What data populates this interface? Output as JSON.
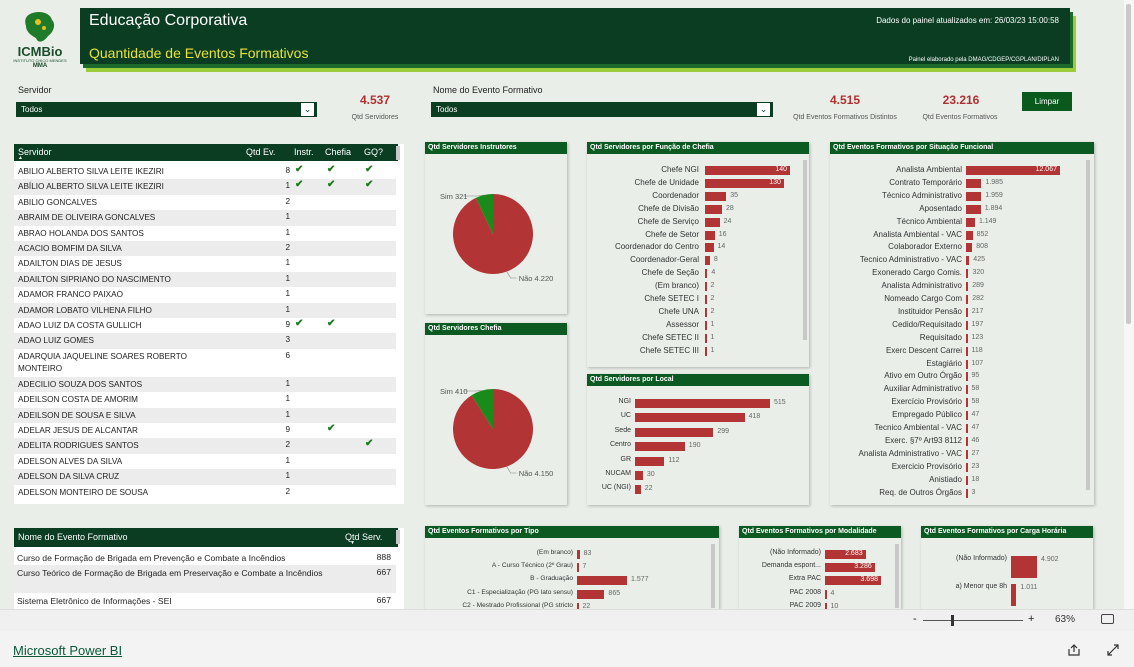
{
  "logo": {
    "text": "ICMBio",
    "small": "INSTITUTO CHICO MENDES",
    "ministry": "MMA"
  },
  "header": {
    "title": "Educação Corporativa",
    "subtitle": "Quantidade de Eventos Formativos",
    "updated": "Dados do painel atualizados em: 26/03/23 15:00:58",
    "credit": "Painel elaborado pela DMAG/CDGEP/CGPLAN/DIPLAN"
  },
  "slicers": {
    "servidor": {
      "label": "Servidor",
      "value": "Todos"
    },
    "evento": {
      "label": "Nome do Evento Formativo",
      "value": "Todos"
    }
  },
  "kpis": {
    "servidores": {
      "value": "4.537",
      "label": "Qtd Servidores"
    },
    "distintos": {
      "value": "4.515",
      "label": "Qtd Eventos Formativos Distintos"
    },
    "eventos": {
      "value": "23.216",
      "label": "Qtd Eventos Formativos"
    }
  },
  "buttons": {
    "limpar": "Limpar"
  },
  "servidor_table": {
    "headers": [
      "Servidor",
      "Qtd Ev.",
      "Instr.",
      "Chefia",
      "GQ?"
    ],
    "rows": [
      {
        "name": "ABILIO ALBERTO SILVA LEITE IKEZIRI",
        "qtd": "8",
        "i": 1,
        "c": 1,
        "g": 1
      },
      {
        "name": "ABÍLIO ALBERTO SILVA LEITE IKEZIRI",
        "qtd": "1",
        "i": 1,
        "c": 1,
        "g": 1
      },
      {
        "name": "ABILIO GONCALVES",
        "qtd": "2",
        "i": 0,
        "c": 0,
        "g": 0
      },
      {
        "name": "ABRAIM DE OLIVEIRA GONCALVES",
        "qtd": "1",
        "i": 0,
        "c": 0,
        "g": 0
      },
      {
        "name": "ABRAO HOLANDA DOS SANTOS",
        "qtd": "1",
        "i": 0,
        "c": 0,
        "g": 0
      },
      {
        "name": "ACACIO BOMFIM DA SILVA",
        "qtd": "2",
        "i": 0,
        "c": 0,
        "g": 0
      },
      {
        "name": "ADAILTON DIAS DE JESUS",
        "qtd": "1",
        "i": 0,
        "c": 0,
        "g": 0
      },
      {
        "name": "ADAILTON SIPRIANO DO NASCIMENTO",
        "qtd": "1",
        "i": 0,
        "c": 0,
        "g": 0
      },
      {
        "name": "ADAMOR FRANCO PAIXAO",
        "qtd": "1",
        "i": 0,
        "c": 0,
        "g": 0
      },
      {
        "name": "ADAMOR LOBATO VILHENA FILHO",
        "qtd": "1",
        "i": 0,
        "c": 0,
        "g": 0
      },
      {
        "name": "ADAO LUIZ DA COSTA GULLICH",
        "qtd": "9",
        "i": 1,
        "c": 1,
        "g": 0
      },
      {
        "name": "ADAO LUIZ GOMES",
        "qtd": "3",
        "i": 0,
        "c": 0,
        "g": 0
      },
      {
        "name": "ADARQUIA JAQUELINE SOARES ROBERTO MONTEIRO",
        "qtd": "6",
        "i": 0,
        "c": 0,
        "g": 0,
        "tall": 1
      },
      {
        "name": "ADECILIO SOUZA DOS SANTOS",
        "qtd": "1",
        "i": 0,
        "c": 0,
        "g": 0
      },
      {
        "name": "ADEILSON COSTA DE AMORIM",
        "qtd": "1",
        "i": 0,
        "c": 0,
        "g": 0
      },
      {
        "name": "ADEILSON DE SOUSA E SILVA",
        "qtd": "1",
        "i": 0,
        "c": 0,
        "g": 0
      },
      {
        "name": "ADELAR JESUS DE ALCANTAR",
        "qtd": "9",
        "i": 0,
        "c": 1,
        "g": 0
      },
      {
        "name": "ADELITA RODRIGUES SANTOS",
        "qtd": "2",
        "i": 0,
        "c": 0,
        "g": 1
      },
      {
        "name": "ADELSON ALVES DA SILVA",
        "qtd": "1",
        "i": 0,
        "c": 0,
        "g": 0
      },
      {
        "name": "ADELSON DA SILVA CRUZ",
        "qtd": "1",
        "i": 0,
        "c": 0,
        "g": 0
      },
      {
        "name": "ADELSON MONTEIRO DE SOUSA",
        "qtd": "2",
        "i": 0,
        "c": 0,
        "g": 0
      }
    ]
  },
  "evento_table": {
    "headers": [
      "Nome do Evento Formativo",
      "Qtd Serv."
    ],
    "rows": [
      {
        "name": "Curso de Formação de Brigada em Prevenção e Combate a Incêndios",
        "qtd": "888"
      },
      {
        "name": "Curso Teórico de Formação de Brigada em Preservação e Combate a Incêndios",
        "qtd": "667"
      },
      {
        "name": "Sistema Eletrônico de Informações - SEI",
        "qtd": "667"
      }
    ]
  },
  "check_symbol": "✔",
  "colors": {
    "bar": "#b33434",
    "green": "#1a8a1a",
    "header": "#0a3d22"
  },
  "chart_data": [
    {
      "id": "instrutores",
      "type": "pie",
      "title": "Qtd Servidores Instrutores",
      "slices": [
        {
          "label": "Sim",
          "value": 321,
          "display": "Sim 321"
        },
        {
          "label": "Não",
          "value": 4220,
          "display": "Não 4.220"
        }
      ]
    },
    {
      "id": "chefia",
      "type": "pie",
      "title": "Qtd Servidores Chefia",
      "slices": [
        {
          "label": "Sim",
          "value": 410,
          "display": "Sim 410"
        },
        {
          "label": "Não",
          "value": 4150,
          "display": "Não 4.150"
        }
      ]
    },
    {
      "id": "funcao",
      "type": "bar",
      "title": "Qtd Servidores por Função de Chefia",
      "categories": [
        "Chefe NGI",
        "Chefe de Unidade",
        "Coordenador",
        "Chefe de Divisão",
        "Chefe de Serviço",
        "Chefe de Setor",
        "Coordenador do Centro",
        "Coordenador-Geral",
        "Chefe de Seção",
        "(Em branco)",
        "Chefe SETEC I",
        "Chefe UNA",
        "Assessor",
        "Chefe SETEC II",
        "Chefe SETEC III"
      ],
      "values": [
        140,
        130,
        35,
        28,
        24,
        16,
        14,
        8,
        4,
        2,
        2,
        2,
        1,
        1,
        1
      ],
      "labels": [
        "140",
        "130",
        "35",
        "28",
        "24",
        "16",
        "14",
        "8",
        "4",
        "2",
        "2",
        "2",
        "1",
        "1",
        "1"
      ]
    },
    {
      "id": "local",
      "type": "bar",
      "title": "Qtd Servidores por Local",
      "categories": [
        "NGI",
        "UC",
        "Sede",
        "Centro",
        "GR",
        "NUCAM",
        "UC (NGI)"
      ],
      "values": [
        515,
        418,
        299,
        190,
        112,
        30,
        22
      ],
      "labels": [
        "515",
        "418",
        "299",
        "190",
        "112",
        "30",
        "22"
      ]
    },
    {
      "id": "situacao",
      "type": "bar",
      "title": "Qtd Eventos Formativos por Situação Funcional",
      "categories": [
        "Analista Ambiental",
        "Contrato Temporário",
        "Técnico Administrativo",
        "Aposentado",
        "Técnico Ambiental",
        "Analista Ambiental - VAC",
        "Colaborador Externo",
        "Tecnico Administrativo - VAC",
        "Exonerado Cargo Comis.",
        "Analista Administrativo",
        "Nomeado Cargo Com",
        "Instituidor Pensão",
        "Cedido/Requisitado",
        "Requisitado",
        "Exerc Descent Carrei",
        "Estagiário",
        "Ativo em Outro Órgão",
        "Auxiliar Administrativo",
        "Exercício Provisório",
        "Empregado Público",
        "Tecnico Ambiental - VAC",
        "Exerc. §7º Art93 8112",
        "Analista Administrativo - VAC",
        "Exercicio Provisório",
        "Anistiado",
        "Req. de Outros Órgãos"
      ],
      "values": [
        12067,
        1985,
        1959,
        1894,
        1149,
        852,
        808,
        425,
        320,
        289,
        282,
        217,
        197,
        123,
        118,
        107,
        95,
        58,
        58,
        47,
        47,
        46,
        27,
        23,
        18,
        3
      ],
      "labels": [
        "12.067",
        "1.985",
        "1.959",
        "1.894",
        "1.149",
        "852",
        "808",
        "425",
        "320",
        "289",
        "282",
        "217",
        "197",
        "123",
        "118",
        "107",
        "95",
        "58",
        "58",
        "47",
        "47",
        "46",
        "27",
        "23",
        "18",
        "3"
      ]
    },
    {
      "id": "tipo",
      "type": "bar",
      "title": "Qtd Eventos Formativos por Tipo",
      "categories": [
        "(Em branco)",
        "A - Curso Técnico (2º Grau)",
        "B - Graduação",
        "C1 - Especialização (PG lato sensu)",
        "C2 - Mestrado Profissional (PG stricto"
      ],
      "values": [
        83,
        7,
        1577,
        865,
        22
      ],
      "labels": [
        "83",
        "7",
        "1.577",
        "865",
        "22"
      ]
    },
    {
      "id": "modalidade",
      "type": "bar",
      "title": "Qtd Eventos Formativos por Modalidade",
      "categories": [
        "(Não Informado)",
        "Demanda espont...",
        "Extra PAC",
        "PAC 2008",
        "PAC 2009"
      ],
      "values": [
        2683,
        3286,
        3698,
        4,
        10
      ],
      "labels": [
        "2.683",
        "3.286",
        "3.698",
        "4",
        "10"
      ]
    },
    {
      "id": "carga",
      "type": "bar",
      "title": "Qtd Eventos Formativos por Carga Horária",
      "categories": [
        "(Não Informado)",
        "a) Menor que 8h"
      ],
      "values": [
        4902,
        1011
      ],
      "labels": [
        "4.902",
        "1.011"
      ]
    }
  ],
  "footer": {
    "zoom": "63%",
    "minus": "-",
    "plus": "+",
    "brand": "Microsoft Power BI"
  }
}
